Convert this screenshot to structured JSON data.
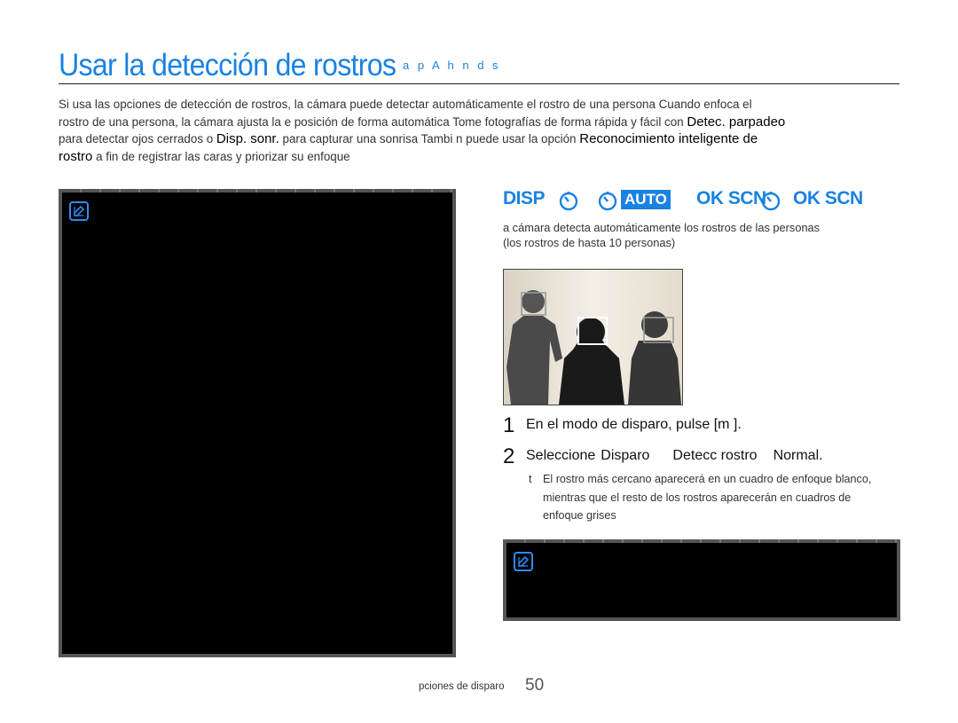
{
  "header": {
    "title": "Usar la detección de rostros",
    "title_tag": "a p A h n d s"
  },
  "intro": {
    "line1": "Si usa las opciones de detección de rostros, la cámara puede detectar automáticamente el rostro de una persona  Cuando enfoca el",
    "line2_a": "rostro de una persona, la cámara ajusta la e  posición de forma automática  Tome fotografías de forma rápida y fácil con ",
    "line2_opt": "Detec. parpadeo",
    "line3_a": "para detectar ojos cerrados o ",
    "line3_opt1": "Disp. sonr.",
    "line3_b": " para capturar una sonrisa  Tambi n puede usar la opción ",
    "line3_opt2": "Reconocimiento inteligente de",
    "line4_opt": "rostro",
    "line4_b": " a fin de registrar las caras y priorizar su enfoque"
  },
  "modes": {
    "disp": "DISP",
    "auto": "AUTO",
    "ok_scn_1": "OK SCN",
    "ok_scn_2": "OK SCN"
  },
  "section": {
    "desc_line1": " a cámara detecta automáticamente los rostros de las personas",
    "desc_line2": "(los rostros de hasta 10 personas)"
  },
  "steps": [
    {
      "num": "1",
      "text": "En el modo de disparo, pulse [m      ]."
    },
    {
      "num": "2",
      "label": "Seleccione",
      "opt1": "Disparo",
      "opt2": "Detecc rostro",
      "opt3": "Normal."
    }
  ],
  "bullet": {
    "mark": "t",
    "text": "El rostro más cercano aparecerá en un cuadro de enfoque blanco, mientras que el resto de los rostros aparecerán en cuadros de enfoque grises"
  },
  "footer": {
    "section": "pciones de disparo",
    "page": "50"
  },
  "colors": {
    "accent": "#1a82e2",
    "note_bg": "#000000",
    "note_border": "#555555"
  },
  "icons": {
    "note": "note-pencil-icon",
    "timer": "self-timer-icon"
  }
}
